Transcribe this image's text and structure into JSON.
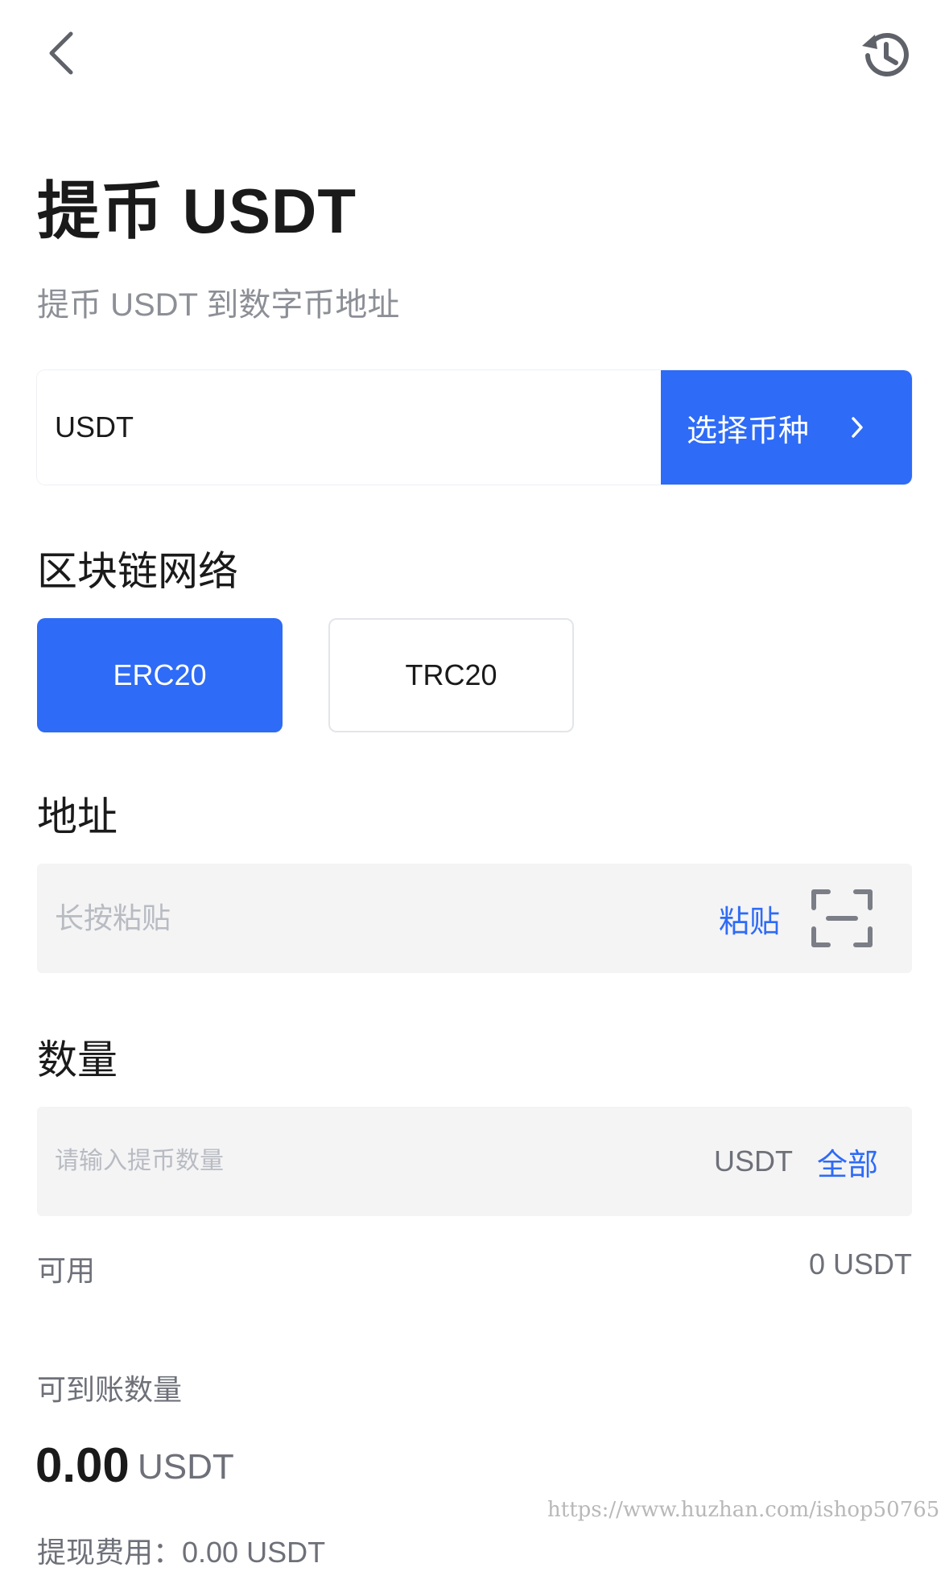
{
  "nav": {
    "back_icon": "chevron-left-icon",
    "history_icon": "history-icon"
  },
  "header": {
    "title": "提币 USDT",
    "subtitle": "提币 USDT 到数字币地址"
  },
  "coin": {
    "value": "USDT",
    "select_label": "选择币种",
    "select_icon": "chevron-right-icon"
  },
  "network": {
    "label": "区块链网络",
    "options": [
      "ERC20",
      "TRC20"
    ],
    "selected": "ERC20"
  },
  "address": {
    "label": "地址",
    "placeholder": "长按粘贴",
    "paste_label": "粘贴",
    "scan_icon": "scan-icon"
  },
  "quantity": {
    "label": "数量",
    "placeholder": "请输入提币数量",
    "unit": "USDT",
    "all_label": "全部"
  },
  "available": {
    "label": "可用",
    "value": "0 USDT"
  },
  "receivable": {
    "label": "可到账数量",
    "amount": "0.00",
    "unit": "USDT"
  },
  "fee": {
    "text": "提现费用：0.00 USDT"
  },
  "watermark": "https://www.huzhan.com/ishop50765",
  "colors": {
    "accent": "#2e6bf6",
    "field_bg": "#f4f4f5",
    "muted_text": "#6e7079"
  }
}
